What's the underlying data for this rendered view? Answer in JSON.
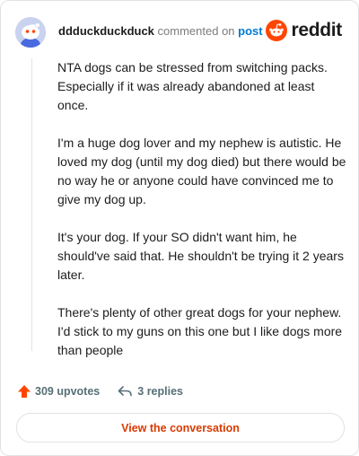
{
  "header": {
    "username": "ddduckduckduck",
    "action_text": "commented on",
    "post_link": "post",
    "brand": "reddit",
    "avatar_icon": "snoo-avatar-icon",
    "brand_icon": "reddit-alien-icon"
  },
  "comment": {
    "paragraphs": [
      "NTA dogs can be stressed from switching packs. Especially if it was already abandoned at least once.",
      "I'm a huge dog lover and my nephew is autistic. He loved my dog (until my dog died) but there would be no way he or anyone could have convinced me to give my dog up.",
      "It's your dog. If your SO didn't want him, he should've said that. He shouldn't be trying it 2 years later.",
      "There's plenty of other great dogs for your nephew. I'd stick to my guns on this one but I like dogs more than people"
    ]
  },
  "footer": {
    "upvotes": "309 upvotes",
    "replies": "3 replies",
    "upvote_icon": "upvote-arrow-icon",
    "reply_icon": "reply-arrow-icon"
  },
  "actions": {
    "view_conversation": "View the conversation"
  },
  "colors": {
    "brand_orange": "#ff4500",
    "link_blue": "#0079d3",
    "button_text": "#d93a00",
    "meta_gray": "#576f76"
  }
}
